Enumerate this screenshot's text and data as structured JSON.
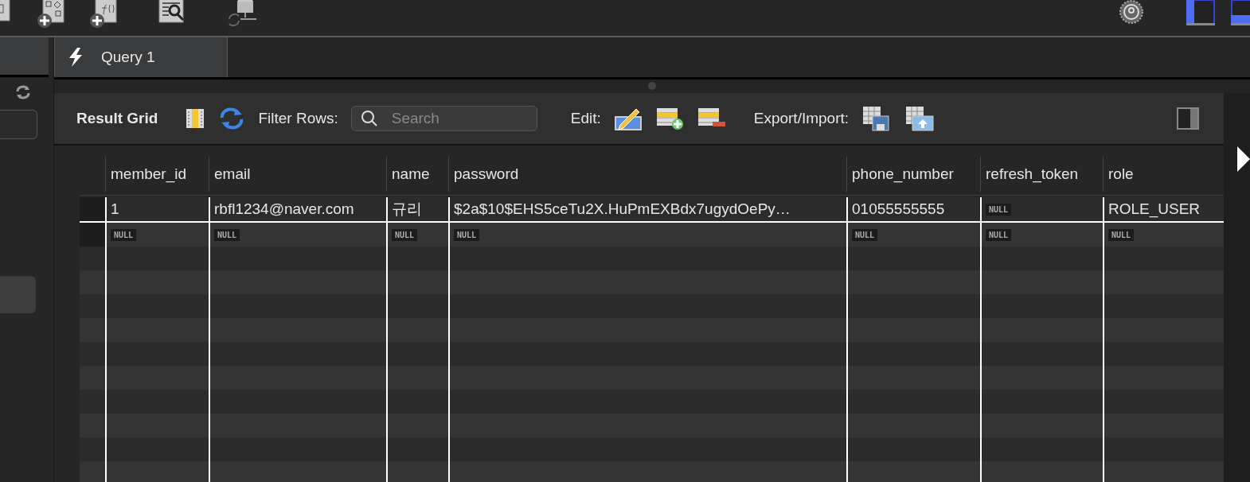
{
  "query_tab": {
    "label": "Query 1",
    "selected": true
  },
  "result_toolbar": {
    "title": "Result Grid",
    "filter_label": "Filter Rows:",
    "search": {
      "placeholder": "Search"
    },
    "edit_label": "Edit:",
    "export_label": "Export/Import:"
  },
  "table": {
    "columns": [
      "member_id",
      "email",
      "name",
      "password",
      "phone_number",
      "refresh_token",
      "role"
    ],
    "rows": [
      {
        "cells": [
          {
            "kind": "value",
            "text": "1"
          },
          {
            "kind": "value",
            "text": "rbfl1234@naver.com"
          },
          {
            "kind": "value",
            "text": "규리"
          },
          {
            "kind": "value",
            "text": "$2a$10$EHS5ceTu2X.HuPmEXBdx7ugydOePy…"
          },
          {
            "kind": "value",
            "text": "01055555555"
          },
          {
            "kind": "null",
            "text": "NULL"
          },
          {
            "kind": "value",
            "text": "ROLE_USER"
          }
        ]
      },
      {
        "cells": [
          {
            "kind": "null",
            "text": "NULL"
          },
          {
            "kind": "null",
            "text": "NULL"
          },
          {
            "kind": "null",
            "text": "NULL"
          },
          {
            "kind": "null",
            "text": "NULL"
          },
          {
            "kind": "null",
            "text": "NULL"
          },
          {
            "kind": "null",
            "text": "NULL"
          },
          {
            "kind": "null",
            "text": "NULL"
          }
        ]
      }
    ]
  }
}
